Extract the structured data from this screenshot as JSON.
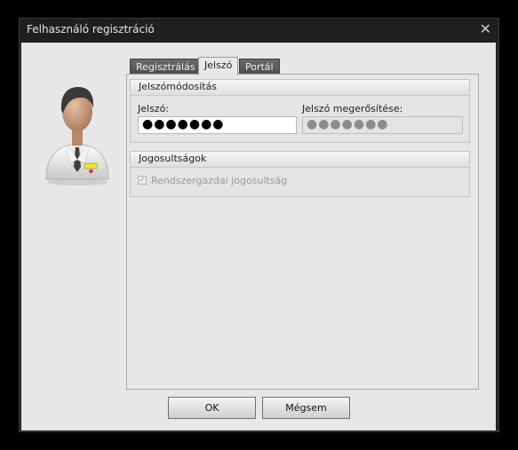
{
  "window": {
    "title": "Felhasználó regisztráció",
    "close_glyph": "✕"
  },
  "tabs": [
    {
      "label": "Regisztrálás",
      "active": false
    },
    {
      "label": "Jelszó",
      "active": true
    },
    {
      "label": "Portál",
      "active": false
    }
  ],
  "password_group": {
    "header": "Jelszómódosítás",
    "password_label": "Jelszó:",
    "password_value": "●●●●●●●",
    "confirm_label": "Jelszó megerősítése:",
    "confirm_value": "●●●●●●●"
  },
  "permissions_group": {
    "header": "Jogosultságok",
    "admin_label": "Rendszergazdai jogosultság",
    "admin_checked": true
  },
  "buttons": {
    "ok": "OK",
    "cancel": "Mégsem"
  },
  "icons": {
    "avatar": "doctor-avatar-icon",
    "close": "close-icon"
  }
}
